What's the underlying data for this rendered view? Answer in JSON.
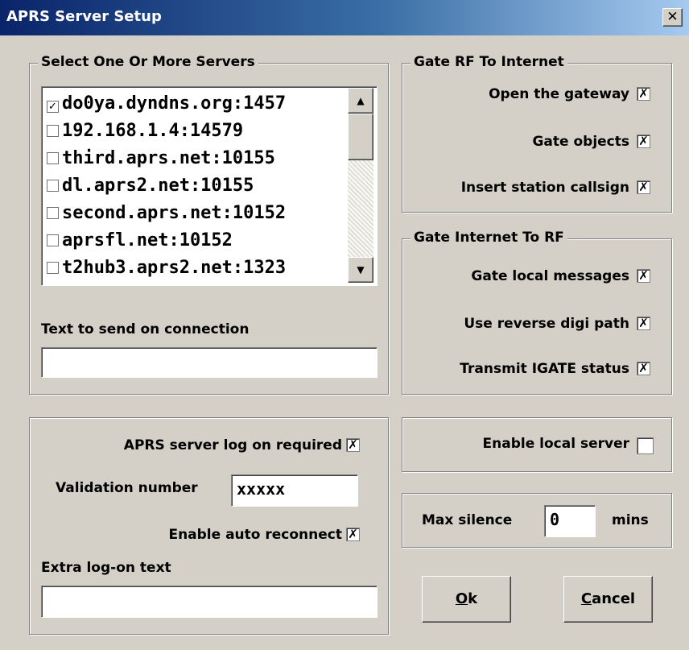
{
  "window": {
    "title": "APRS Server Setup",
    "close_glyph": "✕"
  },
  "servers": {
    "legend": "Select One Or More Servers",
    "items": [
      {
        "label": "do0ya.dyndns.org:1457",
        "checked": true
      },
      {
        "label": "192.168.1.4:14579",
        "checked": false
      },
      {
        "label": "third.aprs.net:10155",
        "checked": false
      },
      {
        "label": "dl.aprs2.net:10155",
        "checked": false
      },
      {
        "label": "second.aprs.net:10152",
        "checked": false
      },
      {
        "label": "aprsfl.net:10152",
        "checked": false
      },
      {
        "label": "t2hub3.aprs2.net:1323",
        "checked": false
      }
    ],
    "connect_text_label": "Text to send on connection",
    "connect_text_value": ""
  },
  "gate_rf": {
    "legend": "Gate RF To Internet",
    "open_gateway": {
      "label": "Open the gateway",
      "checked": true
    },
    "gate_objects": {
      "label": "Gate objects",
      "checked": true
    },
    "insert_callsign": {
      "label": "Insert station callsign",
      "checked": true
    }
  },
  "gate_inet": {
    "legend": "Gate Internet To RF",
    "local_messages": {
      "label": "Gate local messages",
      "checked": true
    },
    "reverse_digi": {
      "label": "Use reverse digi path",
      "checked": true
    },
    "igate_status": {
      "label": "Transmit IGATE status",
      "checked": true
    }
  },
  "logon": {
    "logon_required": {
      "label": "APRS server log on required",
      "checked": true
    },
    "validation_label": "Validation number",
    "validation_value": "xxxxx",
    "auto_reconnect": {
      "label": "Enable auto reconnect",
      "checked": true
    },
    "extra_label": "Extra log-on text",
    "extra_value": ""
  },
  "local_server": {
    "label": "Enable local server",
    "checked": false
  },
  "silence": {
    "label": "Max silence",
    "value": "0",
    "unit": "mins"
  },
  "buttons": {
    "ok_mnemonic": "O",
    "ok_rest": "k",
    "cancel_mnemonic": "C",
    "cancel_rest": "ancel"
  },
  "icons": {
    "check": "✗",
    "list_check": "✓",
    "scroll_up": "▲",
    "scroll_down": "▼"
  }
}
